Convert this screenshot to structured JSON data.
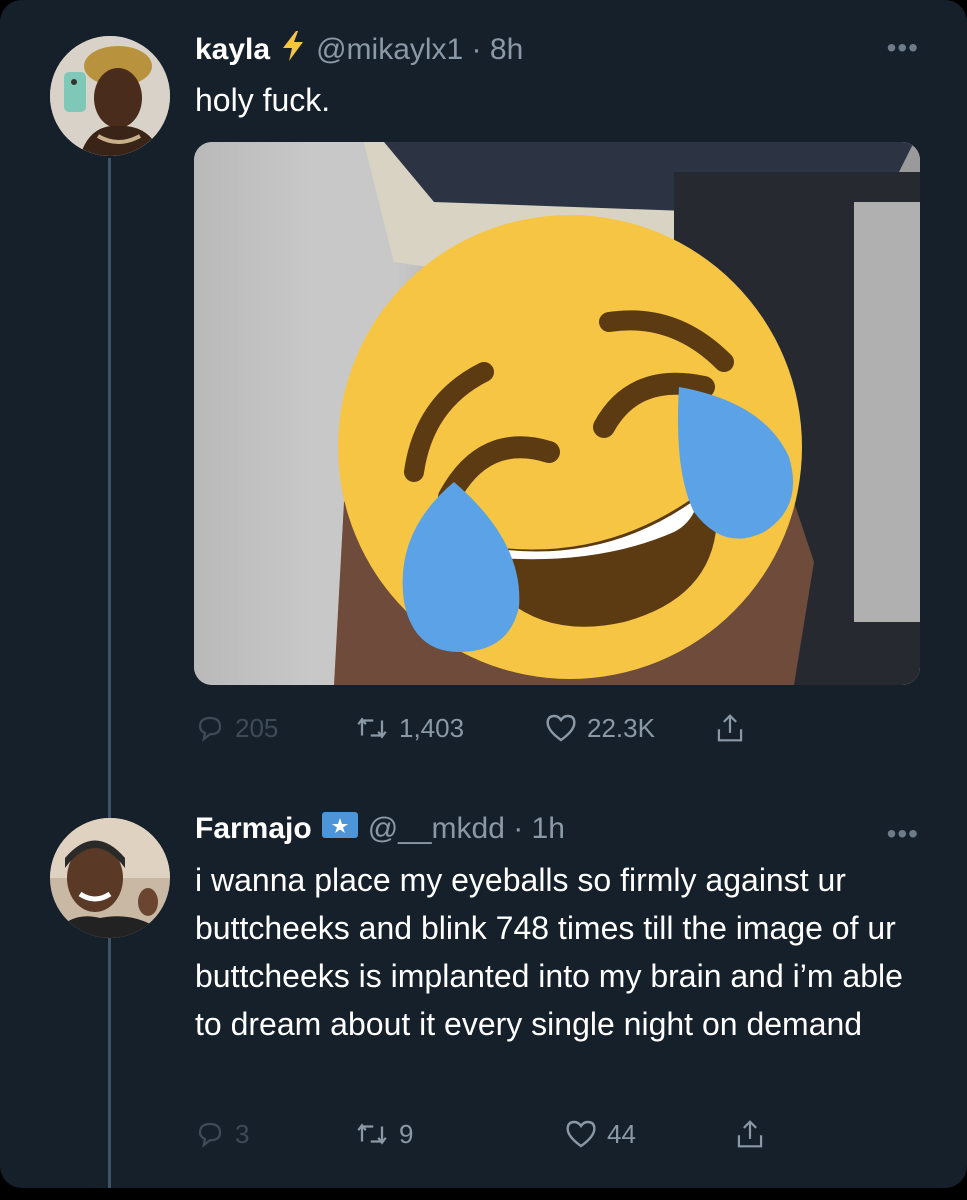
{
  "colors": {
    "background": "#15202b",
    "text_primary": "#ffffff",
    "text_secondary": "#8b98a5",
    "thread_line": "#3d5466",
    "emoji_face": "#f6c544",
    "emoji_tear": "#5ba3e6"
  },
  "tweets": [
    {
      "display_name": "kayla",
      "name_icon": "lightning-bolt-icon",
      "handle_time": "@mikaylx1 · 8h",
      "text": "holy fuck.",
      "media_icon": "face-with-tears-of-joy-emoji",
      "replies": "205",
      "retweets": "1,403",
      "likes": "22.3K"
    },
    {
      "display_name": "Farmajo",
      "name_icon": "somalia-flag-icon",
      "handle_time": "@__mkdd · 1h",
      "text": "i wanna place my eyeballs so firmly against ur buttcheeks and blink 748 times till the image of ur buttcheeks is implanted into my brain and i’m able to dream about it every single night on demand",
      "replies": "3",
      "retweets": "9",
      "likes": "44"
    }
  ]
}
